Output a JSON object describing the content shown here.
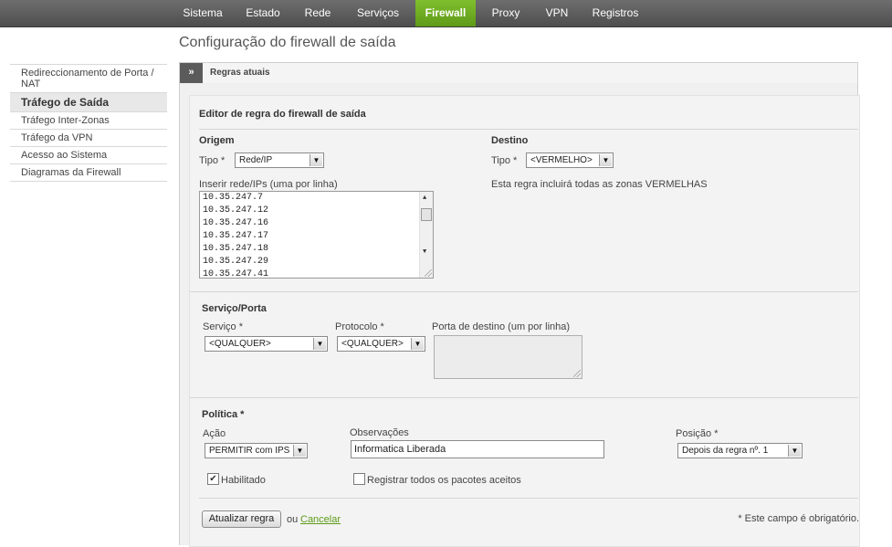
{
  "nav": {
    "items": [
      "Sistema",
      "Estado",
      "Rede",
      "Serviços",
      "Firewall",
      "Proxy",
      "VPN",
      "Registros"
    ],
    "active": "Firewall"
  },
  "page": {
    "title": "Configuração do firewall de saída"
  },
  "sidebar": {
    "items": [
      {
        "label": "Redireccionamento de Porta / NAT"
      },
      {
        "label": "Tráfego de Saída"
      },
      {
        "label": "Tráfego Inter-Zonas"
      },
      {
        "label": "Tráfego da VPN"
      },
      {
        "label": "Acesso ao Sistema"
      },
      {
        "label": "Diagramas da Firewall"
      }
    ],
    "active": "Tráfego de Saída"
  },
  "tab": {
    "arrow": "»",
    "label": "Regras atuais"
  },
  "editor": {
    "title": "Editor de regra do firewall de saída",
    "origem": {
      "title": "Origem",
      "tipo_label": "Tipo *",
      "tipo_value": "Rede/IP",
      "ips_label": "Inserir rede/IPs (uma por linha)",
      "ips": [
        "10.35.247.7",
        "10.35.247.12",
        "10.35.247.16",
        "10.35.247.17",
        "10.35.247.18",
        "10.35.247.29",
        "10.35.247.41"
      ]
    },
    "destino": {
      "title": "Destino",
      "tipo_label": "Tipo *",
      "tipo_value": "<VERMELHO>",
      "note": "Esta regra incluirá todas as zonas VERMELHAS"
    },
    "servico": {
      "title": "Serviço/Porta",
      "servico_label": "Serviço *",
      "servico_value": "<QUALQUER>",
      "protocolo_label": "Protocolo *",
      "protocolo_value": "<QUALQUER>",
      "porta_label": "Porta de destino (um por linha)",
      "porta_value": ""
    },
    "politica": {
      "title": "Política *",
      "acao_label": "Ação",
      "acao_value": "PERMITIR com IPS",
      "obs_label": "Observações",
      "obs_value": "Informatica Liberada",
      "posicao_label": "Posição *",
      "posicao_value": "Depois da regra nº. 1",
      "habilitado_label": "Habilitado",
      "habilitado_checked": true,
      "registrar_label": "Registrar todos os pacotes aceitos",
      "registrar_checked": false
    },
    "actions": {
      "update_label": "Atualizar regra",
      "or_text": "ou",
      "cancel_label": "Cancelar",
      "required_note": "* Este campo é obrigatório."
    }
  },
  "icons": {
    "dropdown": "dropdown-arrow-icon",
    "check": "✔"
  }
}
